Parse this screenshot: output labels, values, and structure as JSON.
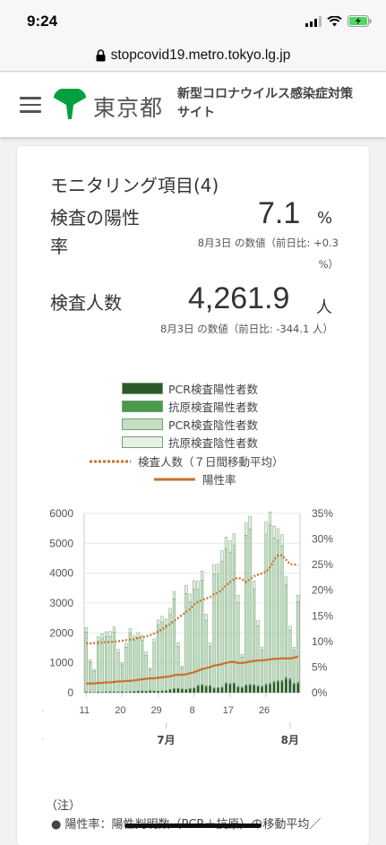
{
  "status_bar": {
    "time": "9:24"
  },
  "browser": {
    "url": "stopcovid19.metro.tokyo.lg.jp"
  },
  "header": {
    "logo_text": "東京都",
    "site_title": "新型コロナウイルス感染症対策サイト"
  },
  "card": {
    "title": "モニタリング項目(4)",
    "positivity": {
      "label_line1": "検査の陽性",
      "label_line2": "率",
      "value": "7.1",
      "unit": "%",
      "note_line1": "8月3日 の数値（前日比: +0.3",
      "note_line2": "%）"
    },
    "tests": {
      "label": "検査人数",
      "value": "4,261.9",
      "unit": "人",
      "note": "8月3日 の数値（前日比: -344.1 人）"
    }
  },
  "legend": [
    {
      "label": "PCR検査陽性者数",
      "color": "#2d5a2d"
    },
    {
      "label": "抗原検査陽性者数",
      "color": "#4a9a4a"
    },
    {
      "label": "PCR検査陰性者数",
      "color": "#c2dfc2"
    },
    {
      "label": "抗原検査陰性者数",
      "color": "#e5f2e5"
    },
    {
      "label": "検査人数（７日間移動平均）",
      "color": "#c9712a",
      "style": "dotted"
    },
    {
      "label": "陽性率",
      "color": "#c9712a",
      "style": "solid"
    }
  ],
  "notes": {
    "head": "（注）",
    "line1": "陽性率：陽性判明数（PCR＋抗原）の移動平均／"
  },
  "chart_data": {
    "type": "bar",
    "title": "",
    "left_axis": {
      "ylim": [
        0,
        6000
      ],
      "ticks": [
        "0",
        "1000",
        "2000",
        "3000",
        "4000",
        "5000",
        "6000"
      ]
    },
    "right_axis": {
      "ylim": [
        0,
        35
      ],
      "ticks": [
        "0%",
        "5%",
        "10%",
        "15%",
        "20%",
        "25%",
        "30%",
        "35%"
      ]
    },
    "x_tick_labels": [
      "11",
      "20",
      "29",
      "8",
      "17",
      "26"
    ],
    "x_month_labels": [
      "7月",
      "8月"
    ],
    "days": [
      "6/11",
      "6/12",
      "6/13",
      "6/14",
      "6/15",
      "6/16",
      "6/17",
      "6/18",
      "6/19",
      "6/20",
      "6/21",
      "6/22",
      "6/23",
      "6/24",
      "6/25",
      "6/26",
      "6/27",
      "6/28",
      "6/29",
      "6/30",
      "7/1",
      "7/2",
      "7/3",
      "7/4",
      "7/5",
      "7/6",
      "7/7",
      "7/8",
      "7/9",
      "7/10",
      "7/11",
      "7/12",
      "7/13",
      "7/14",
      "7/15",
      "7/16",
      "7/17",
      "7/18",
      "7/19",
      "7/20",
      "7/21",
      "7/22",
      "7/23",
      "7/24",
      "7/25",
      "7/26",
      "7/27",
      "7/28",
      "7/29",
      "7/30",
      "7/31",
      "8/1",
      "8/2",
      "8/3"
    ],
    "series": [
      {
        "name": "PCR検査陽性者数",
        "values": [
          20,
          15,
          10,
          25,
          20,
          25,
          30,
          25,
          25,
          30,
          20,
          30,
          40,
          45,
          50,
          45,
          55,
          50,
          45,
          55,
          60,
          100,
          120,
          130,
          110,
          100,
          120,
          140,
          220,
          240,
          200,
          210,
          140,
          145,
          165,
          290,
          270,
          290,
          180,
          160,
          230,
          240,
          230,
          200,
          190,
          250,
          270,
          330,
          350,
          360,
          450,
          420,
          280,
          300
        ]
      },
      {
        "name": "抗原検査陽性者数",
        "values": [
          5,
          5,
          3,
          5,
          5,
          5,
          6,
          5,
          5,
          6,
          4,
          5,
          7,
          8,
          8,
          8,
          9,
          10,
          9,
          10,
          12,
          15,
          18,
          20,
          18,
          16,
          20,
          22,
          30,
          32,
          28,
          30,
          22,
          24,
          28,
          40,
          38,
          40,
          30,
          28,
          35,
          38,
          36,
          32,
          30,
          40,
          42,
          48,
          52,
          55,
          60,
          56,
          40,
          45
        ]
      },
      {
        "name": "PCR検査陰性者数",
        "values": [
          2000,
          1000,
          700,
          1700,
          1800,
          1850,
          1850,
          2000,
          1300,
          900,
          1500,
          1950,
          1700,
          1800,
          1700,
          1200,
          700,
          1600,
          2200,
          2300,
          2200,
          2500,
          3000,
          1400,
          700,
          3200,
          2900,
          3300,
          3200,
          3500,
          2200,
          1300,
          3800,
          3800,
          4200,
          4500,
          4400,
          4600,
          2800,
          1000,
          5000,
          5200,
          3200,
          2000,
          1200,
          5000,
          5300,
          4800,
          4700,
          4500,
          3100,
          1600,
          1100,
          2700
        ]
      },
      {
        "name": "抗原検査陰性者数",
        "values": [
          160,
          80,
          60,
          140,
          150,
          160,
          160,
          170,
          120,
          80,
          130,
          160,
          150,
          160,
          150,
          110,
          70,
          140,
          180,
          190,
          190,
          210,
          250,
          130,
          70,
          280,
          260,
          290,
          280,
          300,
          200,
          120,
          330,
          330,
          360,
          380,
          380,
          390,
          250,
          100,
          420,
          430,
          280,
          180,
          110,
          420,
          440,
          400,
          390,
          380,
          270,
          150,
          100,
          220
        ]
      },
      {
        "name": "検査人数（７日間移動平均）",
        "axis": "left",
        "values": [
          1650,
          1650,
          1660,
          1660,
          1680,
          1690,
          1700,
          1700,
          1720,
          1740,
          1760,
          1780,
          1800,
          1830,
          1850,
          1880,
          1920,
          1980,
          2040,
          2120,
          2220,
          2300,
          2400,
          2500,
          2600,
          2700,
          2800,
          2950,
          3050,
          3100,
          3150,
          3200,
          3300,
          3350,
          3450,
          3600,
          3700,
          3800,
          3850,
          3800,
          3700,
          3800,
          3900,
          3950,
          4000,
          4050,
          4200,
          4450,
          4600,
          4600,
          4450,
          4300,
          4300,
          4262
        ]
      },
      {
        "name": "陽性率",
        "axis": "right",
        "values": [
          1.8,
          1.8,
          1.8,
          1.9,
          1.9,
          2.0,
          2.0,
          2.1,
          2.2,
          2.2,
          2.3,
          2.3,
          2.4,
          2.5,
          2.6,
          2.7,
          2.8,
          2.8,
          2.9,
          3.0,
          3.1,
          3.2,
          3.4,
          3.5,
          3.5,
          3.6,
          3.8,
          4.0,
          4.3,
          4.6,
          4.8,
          5.0,
          5.3,
          5.4,
          5.6,
          5.8,
          6.0,
          6.0,
          5.8,
          5.8,
          5.9,
          6.1,
          6.2,
          6.3,
          6.3,
          6.4,
          6.5,
          6.6,
          6.6,
          6.7,
          6.7,
          6.7,
          6.8,
          7.1
        ]
      }
    ]
  }
}
